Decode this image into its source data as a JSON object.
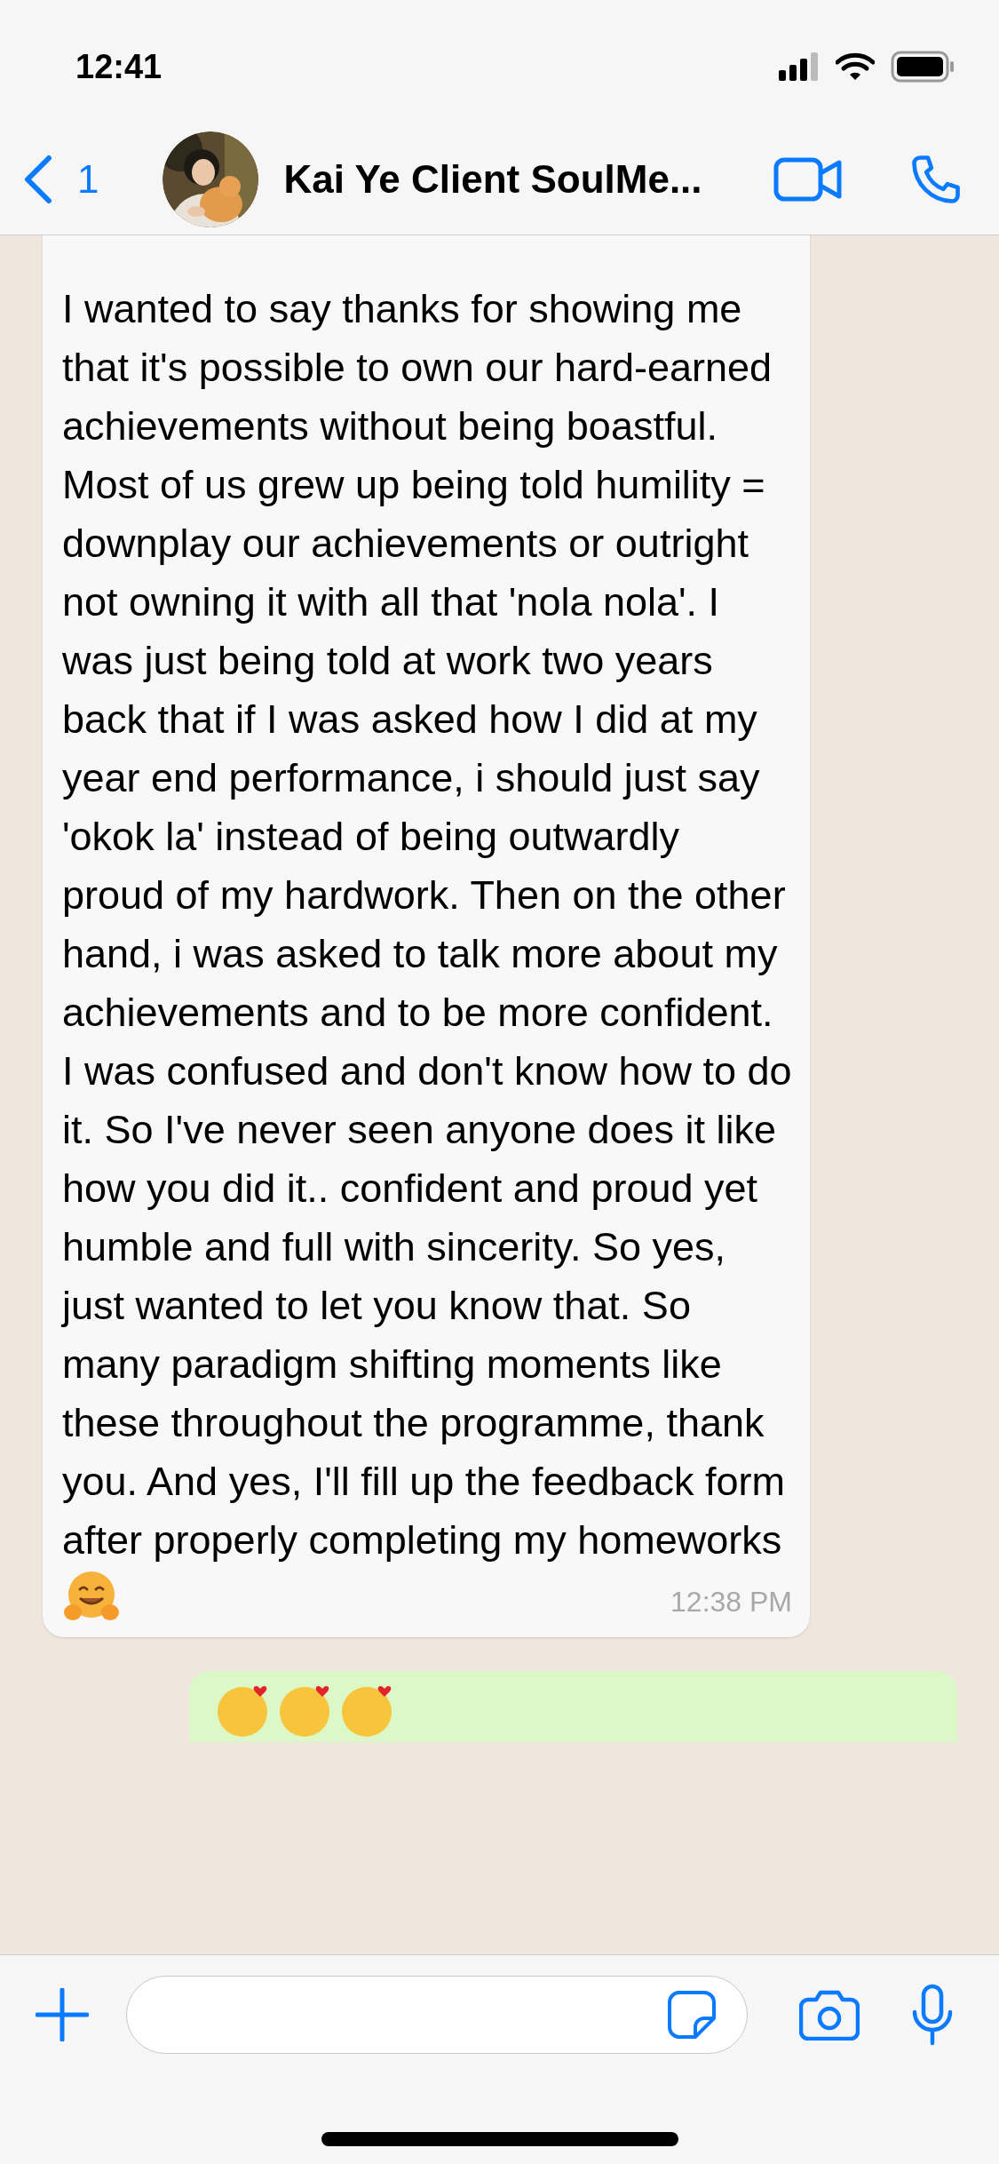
{
  "status_bar": {
    "time": "12:41"
  },
  "header": {
    "back_count": "1",
    "title": "Kai Ye Client SoulMe..."
  },
  "messages": [
    {
      "kind": "incoming",
      "text": "I wanted to say thanks for showing me that it's possible to own our hard-earned achievements without being boastful. Most of us grew up being told humility = downplay our achievements or outright not owning it with all that 'nola nola'. I was just being told at work two years back that if I was asked how I did at my year end performance, i should just say 'okok la' instead of being outwardly proud of my hardwork. Then on the other hand, i was asked to talk more about my achievements and to be more confident. I was confused and don't know how to do it. So I've never seen anyone does it like how you did it.. confident and proud yet humble and full with sincerity. So yes, just wanted to let you know that. So many paradigm shifting moments like these throughout the programme, thank you. And yes, I'll fill up the feedback form after properly completing my homeworks",
      "time": "12:38 PM"
    },
    {
      "kind": "outgoing"
    }
  ]
}
